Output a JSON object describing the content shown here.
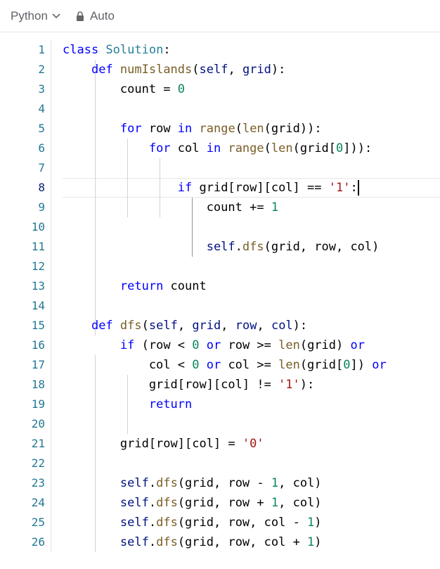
{
  "toolbar": {
    "language": "Python",
    "mode": "Auto"
  },
  "editor": {
    "active_line": 8,
    "line_numbers": [
      "1",
      "2",
      "3",
      "4",
      "5",
      "6",
      "7",
      "8",
      "9",
      "10",
      "11",
      "12",
      "13",
      "14",
      "15",
      "16",
      "17",
      "18",
      "19",
      "20",
      "21",
      "22",
      "23",
      "24",
      "25",
      "26"
    ],
    "code_lines": [
      [
        {
          "t": "class ",
          "c": "kw"
        },
        {
          "t": "Solution",
          "c": "cls"
        },
        {
          "t": ":",
          "c": "tx"
        }
      ],
      [
        {
          "t": "    ",
          "c": "tx"
        },
        {
          "t": "def ",
          "c": "kw"
        },
        {
          "t": "numIslands",
          "c": "fn"
        },
        {
          "t": "(",
          "c": "tx"
        },
        {
          "t": "self",
          "c": "var"
        },
        {
          "t": ", ",
          "c": "tx"
        },
        {
          "t": "grid",
          "c": "var"
        },
        {
          "t": "):",
          "c": "tx"
        }
      ],
      [
        {
          "t": "        count = ",
          "c": "tx"
        },
        {
          "t": "0",
          "c": "num"
        }
      ],
      [],
      [
        {
          "t": "        ",
          "c": "tx"
        },
        {
          "t": "for ",
          "c": "kw"
        },
        {
          "t": "row ",
          "c": "tx"
        },
        {
          "t": "in ",
          "c": "kw"
        },
        {
          "t": "range",
          "c": "fn"
        },
        {
          "t": "(",
          "c": "tx"
        },
        {
          "t": "len",
          "c": "fn"
        },
        {
          "t": "(grid)):",
          "c": "tx"
        }
      ],
      [
        {
          "t": "            ",
          "c": "tx"
        },
        {
          "t": "for ",
          "c": "kw"
        },
        {
          "t": "col ",
          "c": "tx"
        },
        {
          "t": "in ",
          "c": "kw"
        },
        {
          "t": "range",
          "c": "fn"
        },
        {
          "t": "(",
          "c": "tx"
        },
        {
          "t": "len",
          "c": "fn"
        },
        {
          "t": "(grid[",
          "c": "tx"
        },
        {
          "t": "0",
          "c": "num"
        },
        {
          "t": "])):",
          "c": "tx"
        }
      ],
      [],
      [
        {
          "t": "                ",
          "c": "tx"
        },
        {
          "t": "if ",
          "c": "kw"
        },
        {
          "t": "grid[row][col] == ",
          "c": "tx"
        },
        {
          "t": "'1'",
          "c": "str"
        },
        {
          "t": ":",
          "c": "tx"
        }
      ],
      [
        {
          "t": "                    count += ",
          "c": "tx"
        },
        {
          "t": "1",
          "c": "num"
        }
      ],
      [],
      [
        {
          "t": "                    ",
          "c": "tx"
        },
        {
          "t": "self",
          "c": "var"
        },
        {
          "t": ".",
          "c": "tx"
        },
        {
          "t": "dfs",
          "c": "fn"
        },
        {
          "t": "(grid, row, col)",
          "c": "tx"
        }
      ],
      [],
      [
        {
          "t": "        ",
          "c": "tx"
        },
        {
          "t": "return ",
          "c": "kw"
        },
        {
          "t": "count",
          "c": "tx"
        }
      ],
      [],
      [
        {
          "t": "    ",
          "c": "tx"
        },
        {
          "t": "def ",
          "c": "kw"
        },
        {
          "t": "dfs",
          "c": "fn"
        },
        {
          "t": "(",
          "c": "tx"
        },
        {
          "t": "self",
          "c": "var"
        },
        {
          "t": ", ",
          "c": "tx"
        },
        {
          "t": "grid",
          "c": "var"
        },
        {
          "t": ", ",
          "c": "tx"
        },
        {
          "t": "row",
          "c": "var"
        },
        {
          "t": ", ",
          "c": "tx"
        },
        {
          "t": "col",
          "c": "var"
        },
        {
          "t": "):",
          "c": "tx"
        }
      ],
      [
        {
          "t": "        ",
          "c": "tx"
        },
        {
          "t": "if ",
          "c": "kw"
        },
        {
          "t": "(row < ",
          "c": "tx"
        },
        {
          "t": "0 ",
          "c": "num"
        },
        {
          "t": "or ",
          "c": "kw"
        },
        {
          "t": "row >= ",
          "c": "tx"
        },
        {
          "t": "len",
          "c": "fn"
        },
        {
          "t": "(grid) ",
          "c": "tx"
        },
        {
          "t": "or",
          "c": "kw"
        }
      ],
      [
        {
          "t": "            col < ",
          "c": "tx"
        },
        {
          "t": "0 ",
          "c": "num"
        },
        {
          "t": "or ",
          "c": "kw"
        },
        {
          "t": "col >= ",
          "c": "tx"
        },
        {
          "t": "len",
          "c": "fn"
        },
        {
          "t": "(grid[",
          "c": "tx"
        },
        {
          "t": "0",
          "c": "num"
        },
        {
          "t": "]) ",
          "c": "tx"
        },
        {
          "t": "or",
          "c": "kw"
        }
      ],
      [
        {
          "t": "            grid[row][col] != ",
          "c": "tx"
        },
        {
          "t": "'1'",
          "c": "str"
        },
        {
          "t": "):",
          "c": "tx"
        }
      ],
      [
        {
          "t": "            ",
          "c": "tx"
        },
        {
          "t": "return",
          "c": "kw"
        }
      ],
      [],
      [
        {
          "t": "        grid[row][col] = ",
          "c": "tx"
        },
        {
          "t": "'0'",
          "c": "str"
        }
      ],
      [],
      [
        {
          "t": "        ",
          "c": "tx"
        },
        {
          "t": "self",
          "c": "var"
        },
        {
          "t": ".",
          "c": "tx"
        },
        {
          "t": "dfs",
          "c": "fn"
        },
        {
          "t": "(grid, row - ",
          "c": "tx"
        },
        {
          "t": "1",
          "c": "num"
        },
        {
          "t": ", col)",
          "c": "tx"
        }
      ],
      [
        {
          "t": "        ",
          "c": "tx"
        },
        {
          "t": "self",
          "c": "var"
        },
        {
          "t": ".",
          "c": "tx"
        },
        {
          "t": "dfs",
          "c": "fn"
        },
        {
          "t": "(grid, row + ",
          "c": "tx"
        },
        {
          "t": "1",
          "c": "num"
        },
        {
          "t": ", col)",
          "c": "tx"
        }
      ],
      [
        {
          "t": "        ",
          "c": "tx"
        },
        {
          "t": "self",
          "c": "var"
        },
        {
          "t": ".",
          "c": "tx"
        },
        {
          "t": "dfs",
          "c": "fn"
        },
        {
          "t": "(grid, row, col - ",
          "c": "tx"
        },
        {
          "t": "1",
          "c": "num"
        },
        {
          "t": ")",
          "c": "tx"
        }
      ],
      [
        {
          "t": "        ",
          "c": "tx"
        },
        {
          "t": "self",
          "c": "var"
        },
        {
          "t": ".",
          "c": "tx"
        },
        {
          "t": "dfs",
          "c": "fn"
        },
        {
          "t": "(grid, row, col + ",
          "c": "tx"
        },
        {
          "t": "1",
          "c": "num"
        },
        {
          "t": ")",
          "c": "tx"
        }
      ]
    ]
  }
}
